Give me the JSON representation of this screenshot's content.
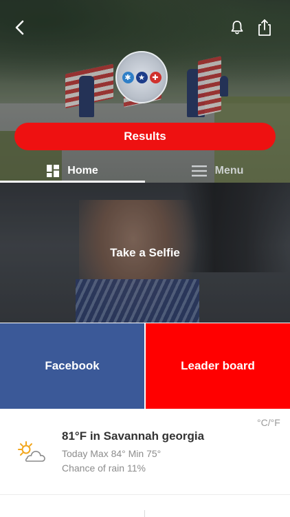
{
  "header": {
    "back_icon": "chevron-left-icon",
    "bell_icon": "bell-icon",
    "share_icon": "share-icon",
    "logo_icons": [
      "star-of-life-icon",
      "star-icon",
      "fire-department-icon"
    ],
    "results_label": "Results"
  },
  "tabs": [
    {
      "label": "Home",
      "icon": "grid-icon",
      "selected": true
    },
    {
      "label": "Menu",
      "icon": "hamburger-icon",
      "selected": false
    }
  ],
  "tiles": {
    "selfie_label": "Take a Selfie",
    "facebook_label": "Facebook",
    "leaderboard_label": "Leader board"
  },
  "weather": {
    "unit_toggle": "°C/°F",
    "title": "81°F in Savannah georgia",
    "minmax": "Today Max 84° Min 75°",
    "rain": "Chance of rain 11%",
    "icon": "partly-cloudy-icon"
  },
  "colors": {
    "red": "#ee1111",
    "facebook_blue": "#3b5998",
    "leaderboard_red": "#ff0000"
  }
}
